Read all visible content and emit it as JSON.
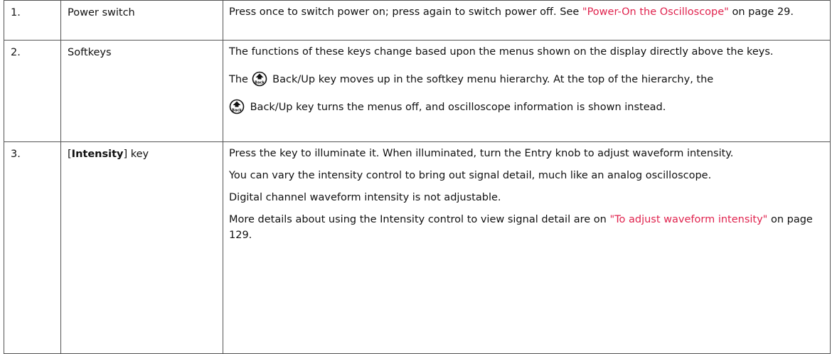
{
  "rows": [
    {
      "num": "1.",
      "name": "Power switch",
      "desc": {
        "text1": "Press once to switch power on; press again to switch power off. See ",
        "link1": "\"Power-On the Oscilloscope\"",
        "text2": " on page 29."
      }
    },
    {
      "num": "2.",
      "name": "Softkeys",
      "p1": "The functions of these keys change based upon the menus shown on the display directly above the keys.",
      "p2_pre": "The ",
      "p2_post": " Back/Up key moves up in the softkey menu hierarchy. At the top of the hierarchy, the",
      "p3_post": " Back/Up key turns the menus off, and oscilloscope information is shown instead.",
      "icon_label": "Back"
    },
    {
      "num": "3.",
      "name_open": "[",
      "name_bold": "Intensity",
      "name_close": "] key",
      "p1": "Press the key to illuminate it. When illuminated, turn the Entry knob to adjust waveform intensity.",
      "p2": "You can vary the intensity control to bring out signal detail, much like an analog oscilloscope.",
      "p3": "Digital channel waveform intensity is not adjustable.",
      "p4_pre": "More details about using the Intensity control to view signal detail are on ",
      "p4_link": "\"To adjust waveform intensity\"",
      "p4_post": " on page 129."
    }
  ],
  "colors": {
    "link": "#e0234e",
    "border": "#555555"
  }
}
